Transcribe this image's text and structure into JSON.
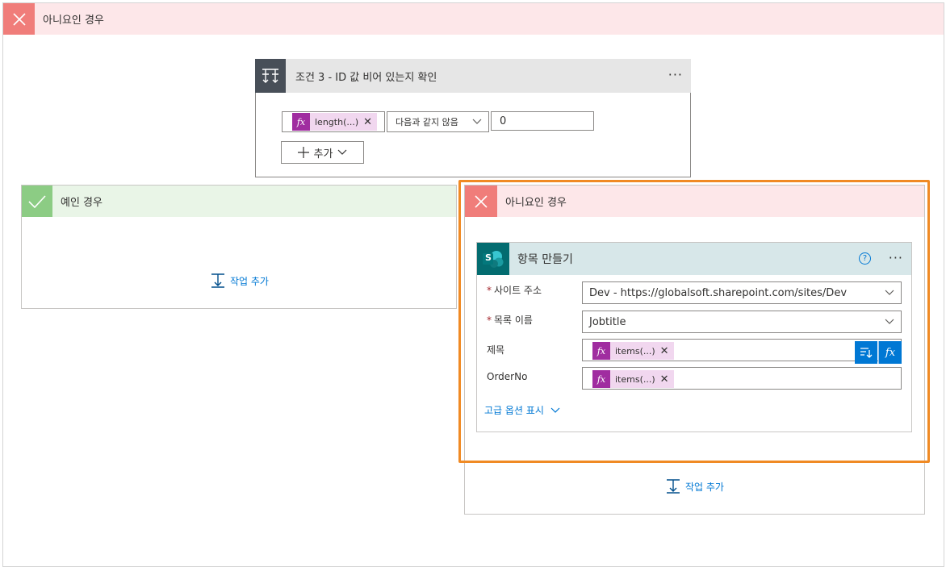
{
  "outer": {
    "header": "아니요인 경우"
  },
  "condition": {
    "title": "조건 3 - ID 값 비어 있는지 확인",
    "token_label": "length(...)",
    "operator": "다음과 같지 않음",
    "value": "0",
    "add_label": "추가",
    "menu_glyph": "···"
  },
  "yes_branch": {
    "title": "예인 경우",
    "add_action": "작업 추가"
  },
  "no_branch": {
    "title": "아니요인 경우",
    "add_action": "작업 추가",
    "create_item": {
      "title": "항목 만들기",
      "help_glyph": "?",
      "menu_glyph": "···",
      "site_label": "사이트 주소",
      "site_value": "Dev - https://globalsoft.sharepoint.com/sites/Dev",
      "list_label": "목록 이름",
      "list_value": "Jobtitle",
      "title_label": "제목",
      "title_token": "items(...)",
      "orderno_label": "OrderNo",
      "orderno_token": "items(...)",
      "advanced": "고급 옵션 표시",
      "required_mark": "*",
      "fx_glyph": "fx",
      "sp_letter": "S"
    }
  },
  "colors": {
    "accent": "#0078d4",
    "highlight": "#f08a24",
    "no_header": "#fde7e9",
    "yes_header": "#e9f5e7",
    "token": "#a02da0"
  }
}
